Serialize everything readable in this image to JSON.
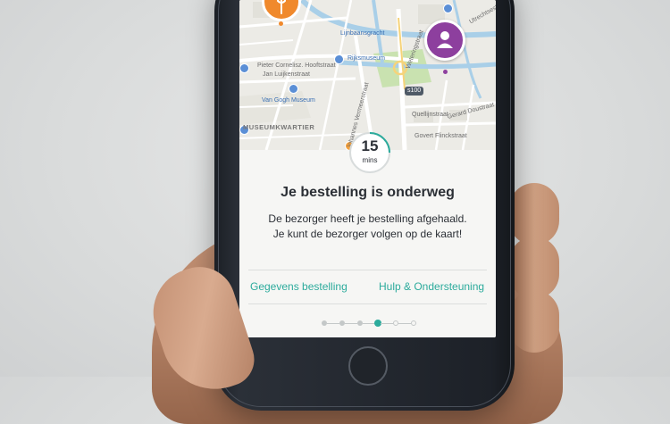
{
  "map": {
    "labels": {
      "street_1": "Pieter Cornelisz. Hooftstraat",
      "street_2": "Jan Luijkenstraat",
      "rijksmuseum": "Rijksmuseum",
      "van_gogh": "Van Gogh Museum",
      "museumkwartier": "MUSEUMKWARTIER",
      "singelgracht": "Lijnbaansgracht",
      "weteringstraat": "Weteringstraat",
      "quellijnstraat": "Quellijnstraat",
      "gerard_dou": "Gerard Doustraat",
      "flinckstraat": "Govert Flinckstraat",
      "utrechtse": "Utrechtsestraat",
      "vermeerstraat": "Johannes Vermeerstraat",
      "road_badge": "s100"
    },
    "courier_pin_icon": "restaurant-icon",
    "user_pin_icon": "person-icon",
    "colors": {
      "user_pin": "#8d3f9e",
      "courier_pin": "#f0892c",
      "water": "#a9cfe8",
      "park": "#c9e2b0"
    }
  },
  "eta": {
    "value": "15",
    "unit": "mins",
    "progress_fraction": 0.25
  },
  "status": {
    "title": "Je bestelling is onderweg",
    "message": "De bezorger heeft je bestelling afgehaald. Je kunt de bezorger volgen op de kaart!"
  },
  "links": {
    "order_details": "Gegevens bestelling",
    "help_support": "Hulp & Ondersteuning"
  },
  "progress": {
    "total_steps": 6,
    "current_step": 4
  },
  "accent_color": "#2cab9c"
}
